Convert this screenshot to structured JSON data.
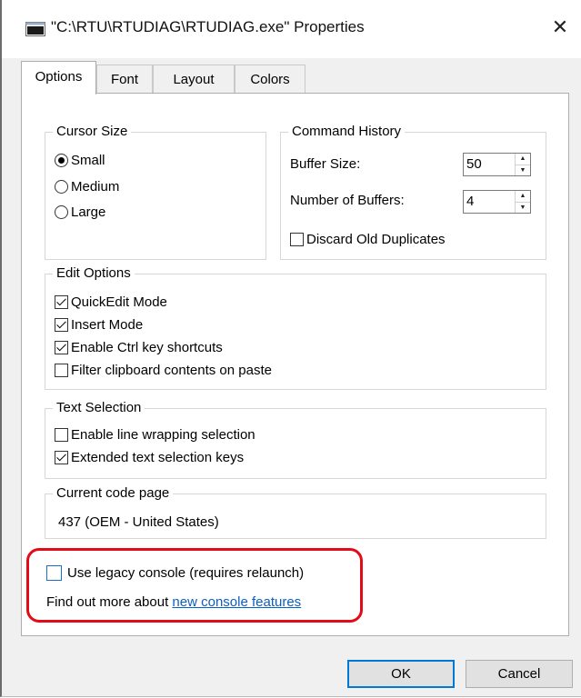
{
  "window": {
    "title": "\"C:\\RTU\\RTUDIAG\\RTUDIAG.exe\" Properties",
    "close_glyph": "✕"
  },
  "tabs": [
    {
      "label": "Options",
      "active": true
    },
    {
      "label": "Font",
      "active": false
    },
    {
      "label": "Layout",
      "active": false
    },
    {
      "label": "Colors",
      "active": false
    }
  ],
  "cursor_size": {
    "title": "Cursor Size",
    "options": [
      {
        "label": "Small",
        "checked": true
      },
      {
        "label": "Medium",
        "checked": false
      },
      {
        "label": "Large",
        "checked": false
      }
    ]
  },
  "command_history": {
    "title": "Command History",
    "buffer_size_label": "Buffer Size:",
    "buffer_size_value": "50",
    "number_of_buffers_label": "Number of Buffers:",
    "number_of_buffers_value": "4",
    "discard_label": "Discard Old Duplicates",
    "discard_checked": false
  },
  "edit_options": {
    "title": "Edit Options",
    "items": [
      {
        "label": "QuickEdit Mode",
        "checked": true
      },
      {
        "label": "Insert Mode",
        "checked": true
      },
      {
        "label": "Enable Ctrl key shortcuts",
        "checked": true
      },
      {
        "label": "Filter clipboard contents on paste",
        "checked": false
      }
    ]
  },
  "text_selection": {
    "title": "Text Selection",
    "items": [
      {
        "label": "Enable line wrapping selection",
        "checked": false
      },
      {
        "label": "Extended text selection keys",
        "checked": true
      }
    ]
  },
  "code_page": {
    "title": "Current code page",
    "value": "437   (OEM - United States)"
  },
  "legacy": {
    "label": "Use legacy console (requires relaunch)",
    "checked": false,
    "find_out_prefix": "Find out more about ",
    "link_text": "new console features"
  },
  "buttons": {
    "ok": "OK",
    "cancel": "Cancel"
  },
  "colors": {
    "highlight_border": "#e30b17",
    "link": "#0a5fc4",
    "default_button_border": "#0078d7"
  }
}
